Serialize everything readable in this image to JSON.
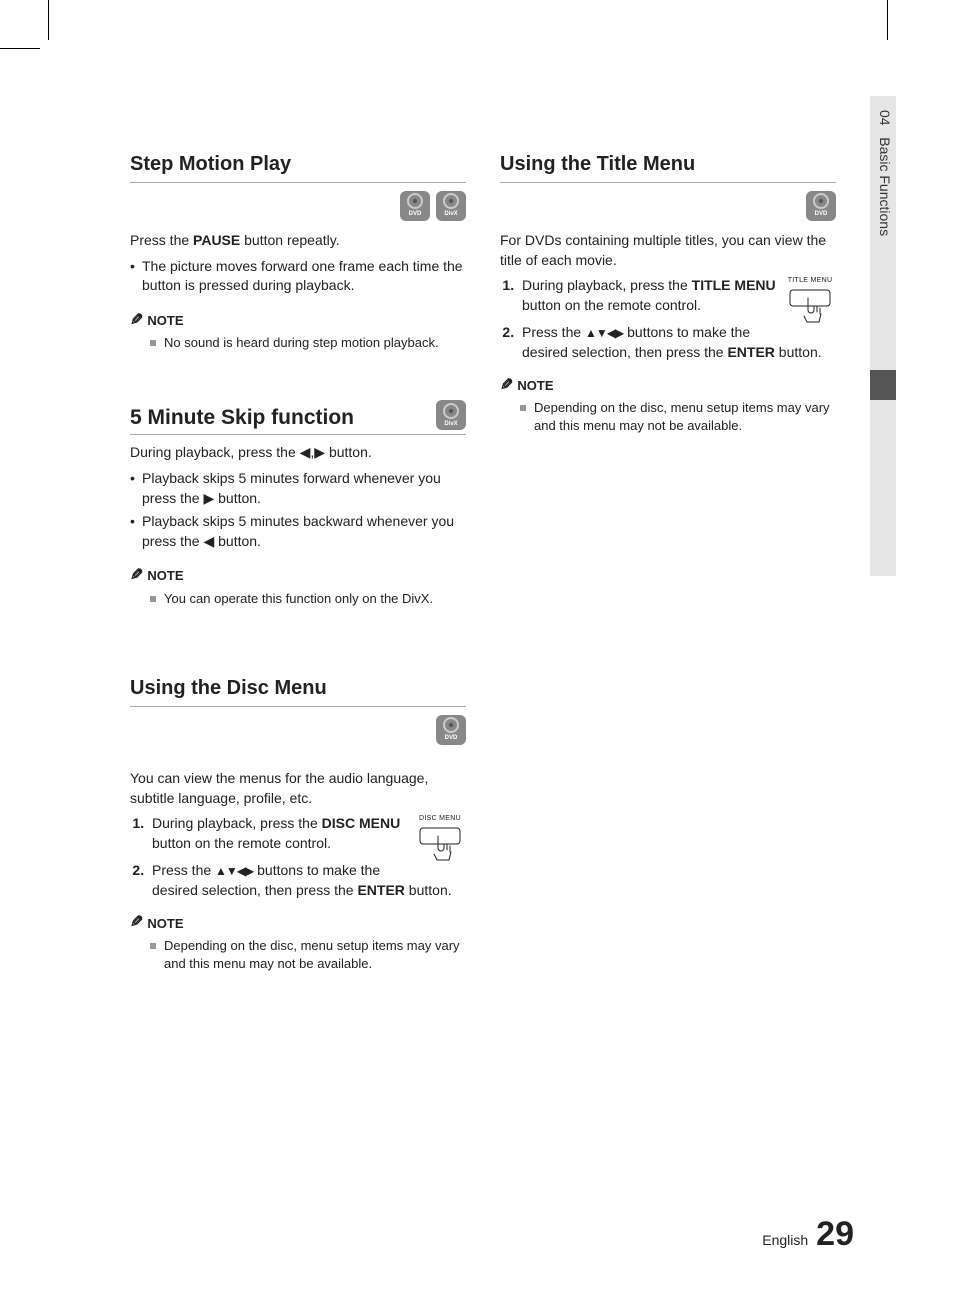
{
  "side": {
    "chapter": "04",
    "name": "Basic Functions"
  },
  "footer": {
    "lang": "English",
    "page": "29"
  },
  "icons": {
    "dvd": "DVD",
    "divx": "DivX"
  },
  "left": {
    "s1": {
      "title": "Step Motion Play",
      "intro_a": "Press the ",
      "intro_b": "PAUSE",
      "intro_c": " button repeatly.",
      "bul1": "The picture moves forward one frame each time the button is pressed during playback.",
      "note_label": "NOTE",
      "note1": "No sound is heard during step motion playback."
    },
    "s2": {
      "title": "5 Minute Skip function",
      "intro": "During playback, press the ◀,▶ button.",
      "bul1": "Playback skips 5 minutes forward whenever you press the ▶ button.",
      "bul2": "Playback skips 5 minutes backward whenever you press the ◀ button.",
      "note_label": "NOTE",
      "note1": "You can operate this function only on the DivX."
    },
    "s3": {
      "title": "Using the Disc Menu",
      "intro": "You can view the menus for the audio language, subtitle language, profile, etc.",
      "step1_a": "During playback, press the ",
      "step1_b": "DISC MENU",
      "step1_c": " button on the remote control.",
      "btn_label": "DISC MENU",
      "step2_a": "Press the ",
      "step2_b": "▲▼◀▶",
      "step2_c": " buttons to make the desired selection, then press the ",
      "step2_d": "ENTER",
      "step2_e": " button.",
      "note_label": "NOTE",
      "note1": "Depending on the disc, menu setup items may vary and this menu may not be available."
    }
  },
  "right": {
    "s1": {
      "title": "Using the Title Menu",
      "intro": "For DVDs containing multiple titles, you can view the title of each movie.",
      "step1_a": "During playback, press the ",
      "step1_b": "TITLE MENU",
      "step1_c": " button on the remote control.",
      "btn_label": "TITLE MENU",
      "step2_a": "Press the ",
      "step2_b": "▲▼◀▶",
      "step2_c": " buttons to make the desired selection, then press the ",
      "step2_d": "ENTER",
      "step2_e": " button.",
      "note_label": "NOTE",
      "note1": "Depending on the disc, menu setup items may vary and this menu may not be available."
    }
  }
}
